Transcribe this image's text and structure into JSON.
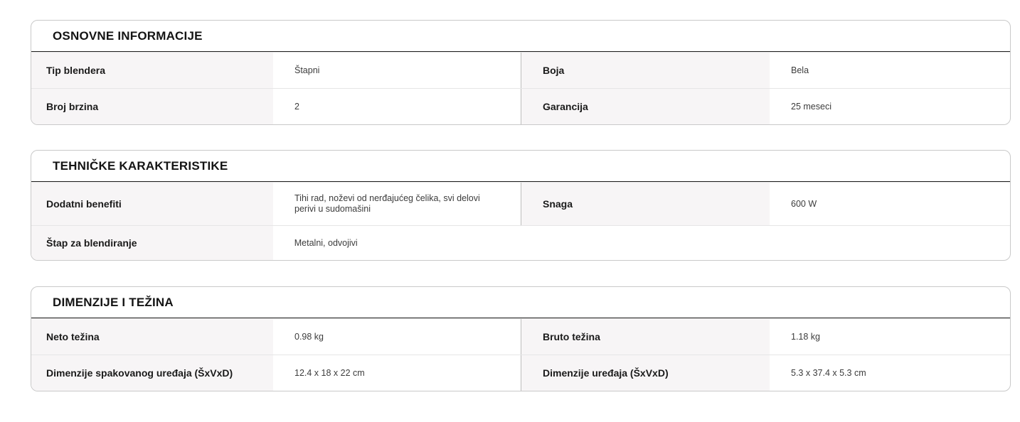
{
  "sections": [
    {
      "title": "OSNOVNE INFORMACIJE",
      "rows": [
        {
          "l1": "Tip blendera",
          "v1": "Štapni",
          "l2": "Boja",
          "v2": "Bela"
        },
        {
          "l1": "Broj brzina",
          "v1": "2",
          "l2": "Garancija",
          "v2": "25 meseci"
        }
      ]
    },
    {
      "title": "TEHNIČKE KARAKTERISTIKE",
      "rows": [
        {
          "l1": "Dodatni benefiti",
          "v1": "Tihi rad, noževi od nerđajućeg čelika, svi delovi perivi u sudomašini",
          "l2": "Snaga",
          "v2": "600 W"
        },
        {
          "l1": "Štap za blendiranje",
          "v1": "Metalni, odvojivi"
        }
      ]
    },
    {
      "title": "DIMENZIJE I TEŽINA",
      "rows": [
        {
          "l1": "Neto težina",
          "v1": "0.98 kg",
          "l2": "Bruto težina",
          "v2": "1.18 kg"
        },
        {
          "l1": "Dimenzije spakovanog uređaja (ŠxVxD)",
          "v1": "12.4 x 18 x 22 cm",
          "l2": "Dimenzije uređaja (ŠxVxD)",
          "v2": "5.3 x 37.4 x 5.3 cm"
        }
      ]
    }
  ]
}
